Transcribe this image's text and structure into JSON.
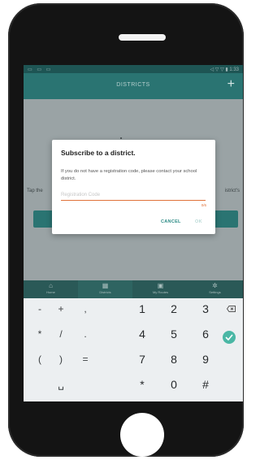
{
  "status_bar": {
    "left": "▭ ▭ ▭",
    "right": "◁ ▽ ▽ ▮ 1:33"
  },
  "app_bar": {
    "title": "DISTRICTS",
    "add_label": "+"
  },
  "background": {
    "left_text": "Tap the",
    "right_text": "istrict's"
  },
  "dialog": {
    "title": "Subscribe to a district.",
    "message": "If you do not have a registration code, please contact your school district.",
    "input_placeholder": "Registration Code",
    "counter": "0/6",
    "cancel_label": "CANCEL",
    "ok_label": "OK"
  },
  "tabs": [
    {
      "label": "Home",
      "icon": "home-icon"
    },
    {
      "label": "Districts",
      "icon": "building-icon"
    },
    {
      "label": "My Routes",
      "icon": "bus-icon"
    },
    {
      "label": "Settings",
      "icon": "gear-icon"
    }
  ],
  "keyboard": {
    "rows": [
      [
        "-",
        "+",
        ",",
        "1",
        "2",
        "3"
      ],
      [
        "*",
        "/",
        ".",
        "4",
        "5",
        "6"
      ],
      [
        "(",
        ")",
        "=",
        "7",
        "8",
        "9"
      ],
      [
        "",
        "␣",
        "",
        "*",
        "0",
        "#"
      ]
    ],
    "backspace_icon": "backspace-icon",
    "enter_icon": "check-icon",
    "accent_color": "#4ab7a5"
  },
  "colors": {
    "primary": "#2a7472",
    "accent": "#e0723a"
  }
}
